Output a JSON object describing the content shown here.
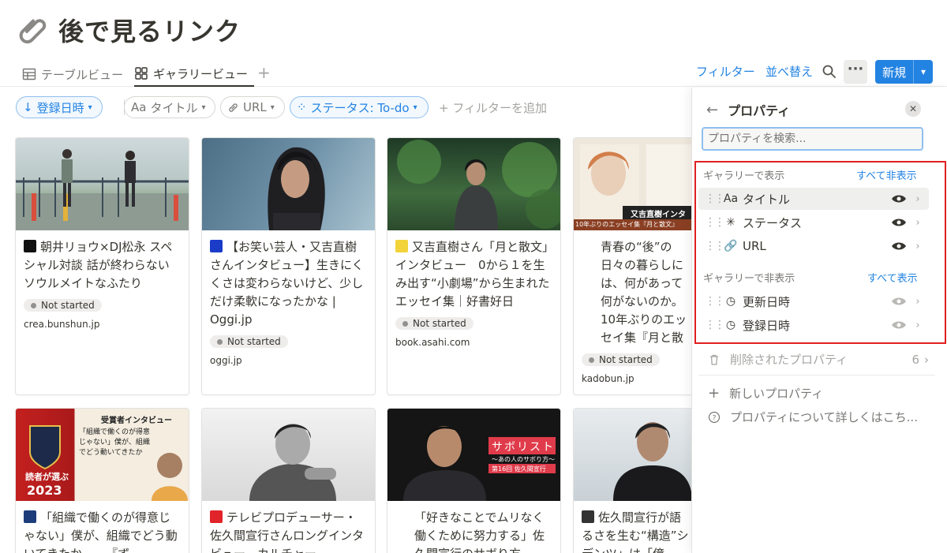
{
  "page": {
    "title": "後で見るリンク"
  },
  "views": {
    "table_label": "テーブルビュー",
    "gallery_label": "ギャラリービュー",
    "add": "+"
  },
  "toolbar": {
    "filter": "フィルター",
    "sort": "並べ替え",
    "more": "···",
    "new": "新規"
  },
  "filters": {
    "sort_chip": "登録日時",
    "title_chip": "タイトル",
    "title_prefix": "Aa",
    "url_chip": "URL",
    "status_chip": "ステータス: To-do",
    "add_filter": "+ フィルターを追加"
  },
  "cards": [
    {
      "title": "朝井リョウ×DJ松永 スペシャル対談 話が終わらないソウルメイトなふたり",
      "status": "Not started",
      "domain": "crea.bunshun.jp"
    },
    {
      "title": "【お笑い芸人・又吉直樹さんインタビュー】生きにくくさは変わらないけど、少しだけ柔軟になったかな | Oggi.jp",
      "status": "Not started",
      "domain": "oggi.jp"
    },
    {
      "title": "又吉直樹さん「月と散文」インタビュー　0から１を生み出す“小劇場”から生まれたエッセイ集｜好書好日",
      "status": "Not started",
      "domain": "book.asahi.com"
    },
    {
      "title": "青春の“後”の日々の暮らしには、何があって何がないのか。 10年ぶりのエッセイ集『月と散文』刊行記念　又吉直樹インタビュー | カドブン",
      "status": "Not started",
      "domain": "kadobun.jp",
      "thumb_text": "又吉直樹インタ",
      "thumb_caption": "10年ぶりのエッセイ集『月と散文』"
    },
    {
      "title": "「組織で働くのが得意じゃない」僕が、組織でどう動いてきたか……『ず",
      "thumb_text_1": "受賞者インタビュー",
      "thumb_text_2": "「組織で働くのが得意じゃない」僕が、組織でどう動いてきたか",
      "thumb_year": "2023",
      "thumb_badge": "読者が選ぶ"
    },
    {
      "title": "テレビプロデューサー・佐久間宣行さんロングインタビュー　カルチャー"
    },
    {
      "title": "「好きなことでムリなく働くために努力する」佐久間宣行のサボり方",
      "thumb_text": "サボリスト",
      "thumb_sub": "〜あの人のサボり方〜",
      "thumb_ep": "第16回 佐久間宣行"
    },
    {
      "title": "佐久間宣行が語るさを生む“構造”シデンツ」は「億"
    }
  ],
  "panel": {
    "title": "プロパティ",
    "search_placeholder": "プロパティを検索...",
    "shown_label": "ギャラリーで表示",
    "hide_all": "すべて非表示",
    "hidden_label": "ギャラリーで非表示",
    "show_all": "すべて表示",
    "shown_props": [
      {
        "icon": "Aa",
        "name": "タイトル"
      },
      {
        "icon": "✳",
        "name": "ステータス"
      },
      {
        "icon": "🔗",
        "name": "URL"
      }
    ],
    "hidden_props": [
      {
        "icon": "◷",
        "name": "更新日時"
      },
      {
        "icon": "◷",
        "name": "登録日時"
      }
    ],
    "deleted_label": "削除されたプロパティ",
    "deleted_count": "6",
    "new_property": "新しいプロパティ",
    "learn_more": "プロパティについて詳しくはこち..."
  },
  "colors": {
    "accent": "#2383e2",
    "highlight_border": "#e02020",
    "text": "#37352f"
  }
}
